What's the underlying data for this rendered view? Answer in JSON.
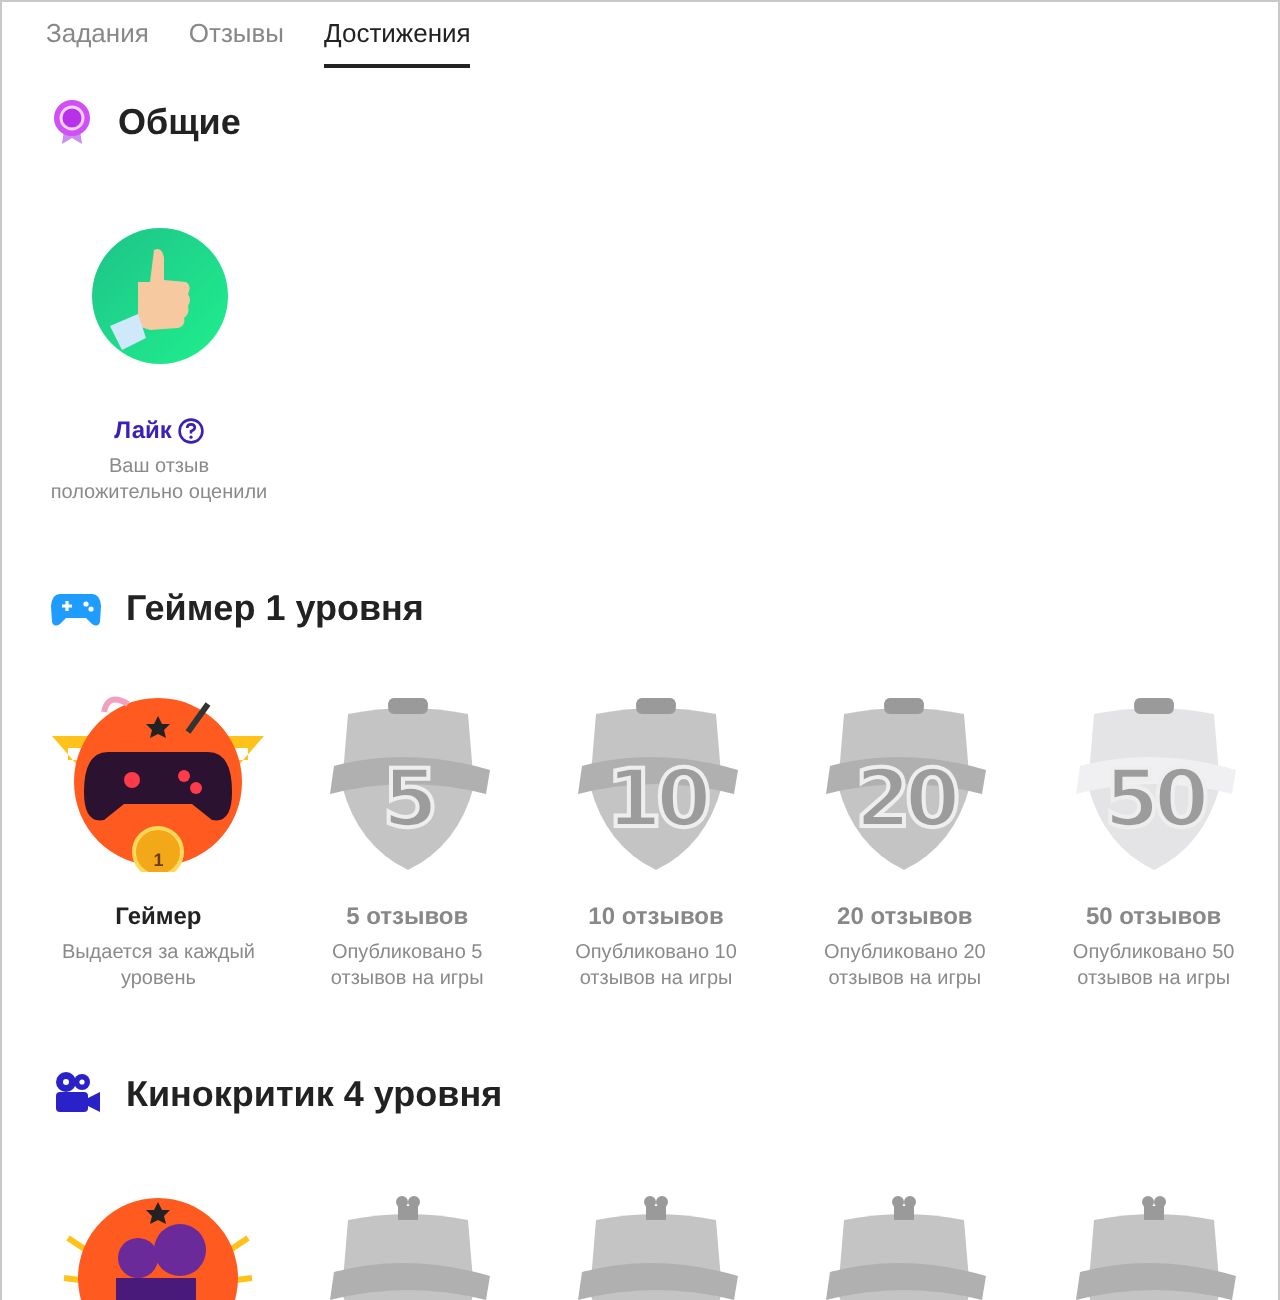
{
  "tabs": [
    {
      "label": "Задания",
      "selected": false
    },
    {
      "label": "Отзывы",
      "selected": false
    },
    {
      "label": "Достижения",
      "selected": true
    }
  ],
  "sections": [
    {
      "title": "Общие",
      "kind": "general",
      "achievements": [
        {
          "title": "Лайк",
          "description": "Ваш отзыв положительно оценили",
          "earned": true,
          "help": true
        }
      ]
    },
    {
      "title": "Геймер 1 уровня",
      "kind": "gamer",
      "achievements": [
        {
          "title": "Геймер",
          "description": "Выдается за каждый уровень",
          "earned": true,
          "number": "1"
        },
        {
          "title": "5 отзывов",
          "description": "Опубликовано 5 отзывов на игры",
          "earned": false,
          "number": "5"
        },
        {
          "title": "10 отзывов",
          "description": "Опубликовано 10 отзывов на игры",
          "earned": false,
          "number": "10"
        },
        {
          "title": "20 отзывов",
          "description": "Опубликовано 20 отзывов на игры",
          "earned": false,
          "number": "20"
        },
        {
          "title": "50 отзывов",
          "description": "Опубликовано 50 отзывов на игры",
          "earned": false,
          "number": "50"
        }
      ]
    },
    {
      "title": "Кинокритик 4 уровня",
      "kind": "film",
      "achievements": [
        {
          "earned": true
        },
        {
          "earned": false
        },
        {
          "earned": false
        },
        {
          "earned": false
        },
        {
          "earned": false
        }
      ]
    }
  ]
}
